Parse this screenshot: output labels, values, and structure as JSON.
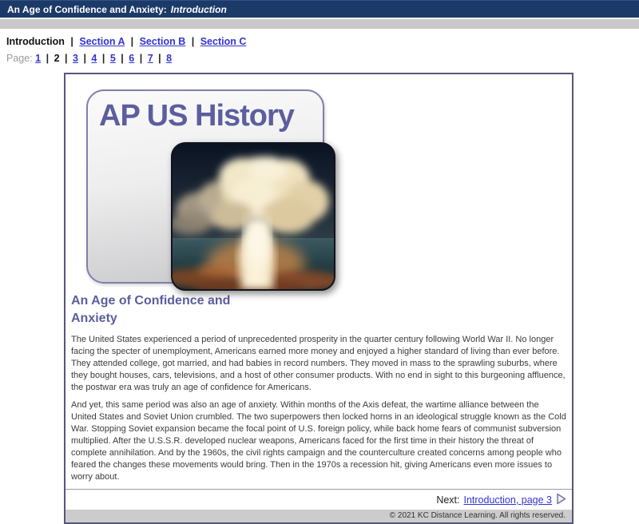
{
  "titlebar": {
    "title": "An Age of Confidence and Anxiety:",
    "section": "Introduction"
  },
  "nav": {
    "current": "Introduction",
    "separator": "|",
    "links": [
      "Section A",
      "Section B",
      "Section C"
    ]
  },
  "pager": {
    "label": "Page:",
    "separator": "|",
    "current": "2",
    "pages": [
      "1",
      "2",
      "3",
      "4",
      "5",
      "6",
      "7",
      "8"
    ]
  },
  "course": {
    "title": "AP US History",
    "image_name": "mushroom-cloud-photo"
  },
  "article": {
    "heading": "An Age of Confidence and Anxiety",
    "paragraphs": [
      "The United States experienced a period of unprecedented prosperity in the quarter century following World War II. No longer facing the specter of unemployment, Americans earned more money and enjoyed a higher standard of living than ever before. They attended college, got married, and had babies in record numbers. They moved in mass to the sprawling suburbs, where they bought houses, cars, televisions, and a host of other consumer products.  With no end in sight to this burgeoning affluence, the postwar era was truly an age of confidence for Americans.",
      "And yet, this same period was also an age of anxiety. Within months of the Axis defeat, the wartime alliance between the United States and Soviet Union crumbled. The two superpowers then locked horns in an ideological struggle known as the Cold War. Stopping Soviet expansion became the focal point of U.S. foreign policy, while back home fears of communist subversion multiplied. After the U.S.S.R. developed nuclear weapons, Americans faced for the first time in their history the threat of complete annihilation. And by the 1960s, the civil rights campaign and the counterculture created concerns among people who feared the changes these movements would bring. Then in the 1970s a recession hit, giving Americans even more issues to worry about."
    ]
  },
  "next": {
    "label": "Next:",
    "link": "Introduction, page 3"
  },
  "footer": {
    "copyright": "© 2021 KC Distance Learning. All rights reserved."
  },
  "colors": {
    "header_navy": "#1c3a68",
    "link_blue": "#3434d0",
    "accent_purple": "#5c5e9e",
    "box_border": "#56567f",
    "footer_gray": "#cccccc"
  }
}
